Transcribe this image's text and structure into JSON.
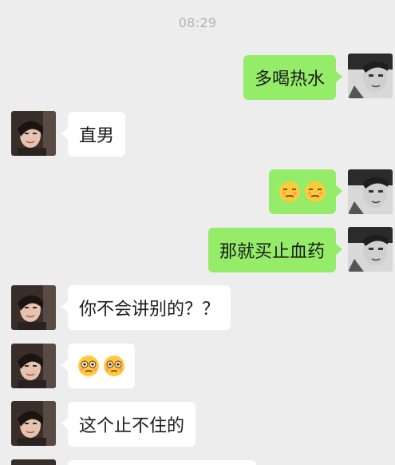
{
  "chat": {
    "timestamp": "08:29",
    "messages": [
      {
        "from": "me",
        "text": "多喝热水"
      },
      {
        "from": "them",
        "text": "直男"
      },
      {
        "from": "me",
        "emoji": [
          "unamused-face-icon",
          "unamused-face-icon"
        ]
      },
      {
        "from": "me",
        "text": "那就买止血药"
      },
      {
        "from": "them",
        "text": "你不会讲别的？？"
      },
      {
        "from": "them",
        "emoji": [
          "flushed-face-icon",
          "flushed-face-icon"
        ]
      },
      {
        "from": "them",
        "text": "这个止不住的"
      }
    ]
  },
  "colors": {
    "background": "#ededed",
    "my_bubble": "#95ec69",
    "their_bubble": "#ffffff",
    "timestamp": "#b2b2b2"
  }
}
